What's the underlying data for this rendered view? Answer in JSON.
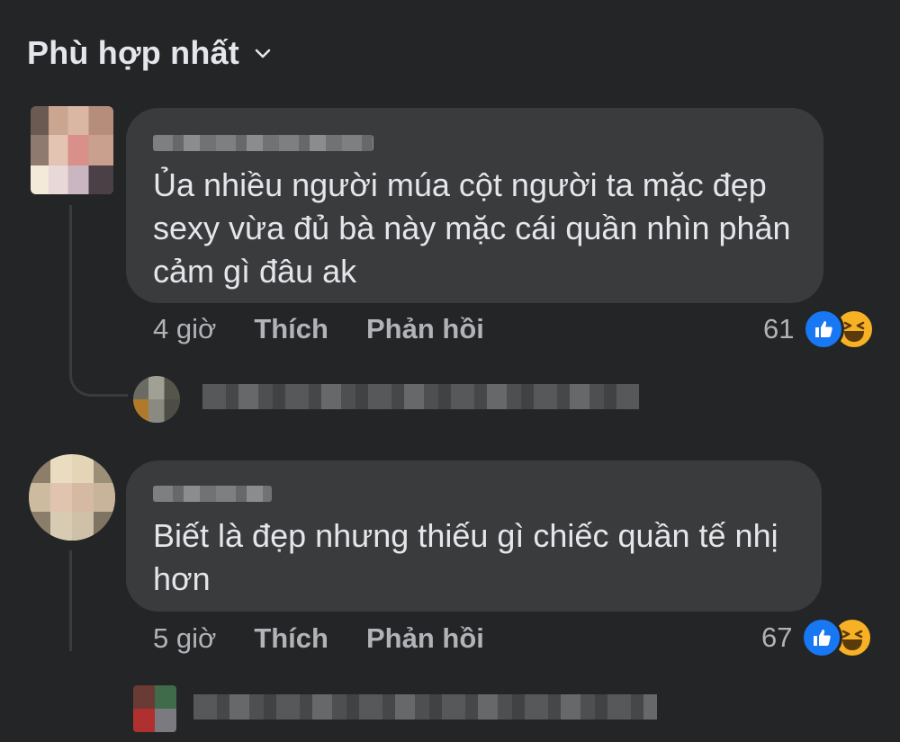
{
  "sort": {
    "label": "Phù hợp nhất",
    "icon": "chevron-down-icon"
  },
  "comments": [
    {
      "author": "",
      "text": "Ủa nhiều người múa cột người ta mặc đẹp sexy vừa đủ bà này mặc cái quần nhìn phản cảm gì đâu ak",
      "lines": [
        "Ủa nhiều người múa cột người ta mặc đẹp",
        "sexy vừa đủ bà này mặc cái quần nhìn phản",
        "cảm gì đâu ak"
      ],
      "time": "4 giờ",
      "like_label": "Thích",
      "reply_label": "Phản hồi",
      "reaction_count": "61",
      "reactions": [
        "like-icon",
        "haha-icon"
      ]
    },
    {
      "author": "",
      "text": "Biết là đẹp nhưng thiếu gì chiếc quần tế nhị hơn",
      "lines": [
        "Biết là đẹp nhưng thiếu gì chiếc quần tế nhị",
        "hơn"
      ],
      "time": "5 giờ",
      "like_label": "Thích",
      "reply_label": "Phản hồi",
      "reaction_count": "67",
      "reactions": [
        "like-icon",
        "haha-icon"
      ]
    }
  ],
  "colors": {
    "background": "#242526",
    "bubble": "#3a3b3c",
    "text": "#e4e6eb",
    "secondary_text": "#b0b3b8",
    "like_blue": "#1877f2",
    "haha_yellow": "#f7b125"
  }
}
